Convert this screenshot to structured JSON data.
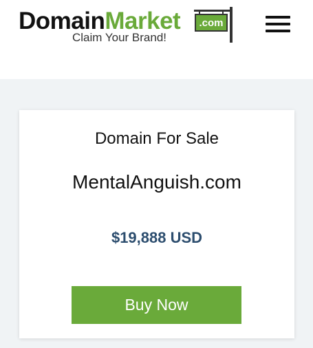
{
  "header": {
    "logo": {
      "word_domain": "Domain",
      "word_market": "Market",
      "sign_text": ".com",
      "tagline": "Claim Your Brand!"
    },
    "menu_icon": "hamburger-menu-icon"
  },
  "listing": {
    "heading": "Domain For Sale",
    "domain": "MentalAnguish.com",
    "price": "$19,888 USD",
    "buy_label": "Buy Now"
  },
  "colors": {
    "brand_green": "#6aaa3a",
    "price_blue": "#2c4d6e",
    "page_background": "#f0f3f5"
  }
}
